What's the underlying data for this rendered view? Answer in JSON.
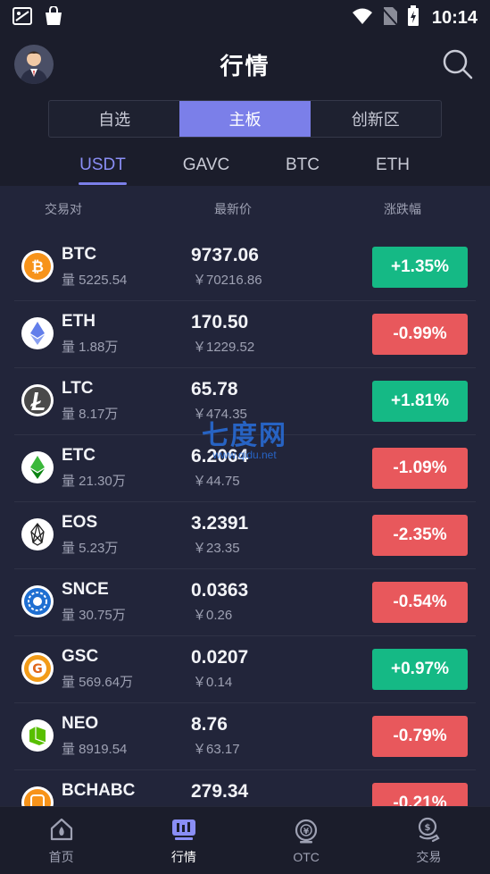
{
  "status_bar": {
    "time": "10:14"
  },
  "header": {
    "title": "行情"
  },
  "segments": [
    {
      "label": "自选",
      "active": false
    },
    {
      "label": "主板",
      "active": true
    },
    {
      "label": "创新区",
      "active": false
    }
  ],
  "quote_tabs": [
    {
      "label": "USDT",
      "active": true
    },
    {
      "label": "GAVC",
      "active": false
    },
    {
      "label": "BTC",
      "active": false
    },
    {
      "label": "ETH",
      "active": false
    }
  ],
  "columns": {
    "pair": "交易对",
    "price": "最新价",
    "change": "涨跌幅"
  },
  "rows": [
    {
      "symbol": "BTC",
      "volume": "量 5225.54",
      "price": "9737.06",
      "cny": "￥70216.86",
      "change": "+1.35%",
      "direction": "up",
      "icon": "bitcoin-icon"
    },
    {
      "symbol": "ETH",
      "volume": "量 1.88万",
      "price": "170.50",
      "cny": "￥1229.52",
      "change": "-0.99%",
      "direction": "down",
      "icon": "ethereum-icon"
    },
    {
      "symbol": "LTC",
      "volume": "量 8.17万",
      "price": "65.78",
      "cny": "￥474.35",
      "change": "+1.81%",
      "direction": "up",
      "icon": "litecoin-icon"
    },
    {
      "symbol": "ETC",
      "volume": "量 21.30万",
      "price": "6.2064",
      "cny": "￥44.75",
      "change": "-1.09%",
      "direction": "down",
      "icon": "ethereum-classic-icon"
    },
    {
      "symbol": "EOS",
      "volume": "量 5.23万",
      "price": "3.2391",
      "cny": "￥23.35",
      "change": "-2.35%",
      "direction": "down",
      "icon": "eos-icon"
    },
    {
      "symbol": "SNCE",
      "volume": "量 30.75万",
      "price": "0.0363",
      "cny": "￥0.26",
      "change": "-0.54%",
      "direction": "down",
      "icon": "snce-icon"
    },
    {
      "symbol": "GSC",
      "volume": "量 569.64万",
      "price": "0.0207",
      "cny": "￥0.14",
      "change": "+0.97%",
      "direction": "up",
      "icon": "gsc-icon"
    },
    {
      "symbol": "NEO",
      "volume": "量 8919.54",
      "price": "8.76",
      "cny": "￥63.17",
      "change": "-0.79%",
      "direction": "down",
      "icon": "neo-icon"
    },
    {
      "symbol": "BCHABC",
      "volume": "",
      "price": "279.34",
      "cny": "",
      "change": "-0.21%",
      "direction": "down",
      "icon": "bchabc-icon"
    }
  ],
  "watermark": {
    "big": "七度网",
    "small": "www.qidu.net"
  },
  "bottom_nav": [
    {
      "label": "首页",
      "icon": "home-icon",
      "active": false
    },
    {
      "label": "行情",
      "icon": "market-icon",
      "active": true
    },
    {
      "label": "OTC",
      "icon": "otc-icon",
      "active": false
    },
    {
      "label": "交易",
      "icon": "trade-icon",
      "active": false
    }
  ],
  "colors": {
    "accent": "#7b7fe9",
    "up": "#15b985",
    "down": "#e8585c",
    "background": "#1b1d2b",
    "list_background": "#22253a"
  }
}
